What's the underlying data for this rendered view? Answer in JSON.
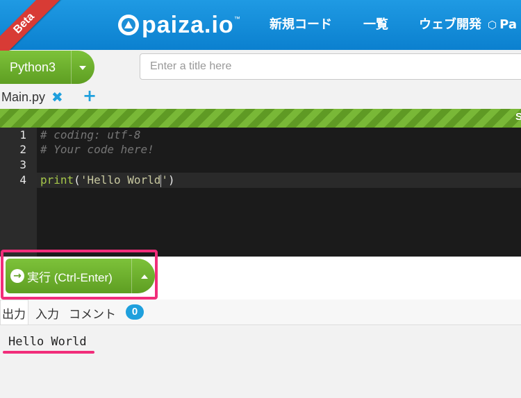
{
  "header": {
    "beta_label": "Beta",
    "logo_text": "paiza.io",
    "logo_tm": "™",
    "nav": [
      {
        "label": "新規コード"
      },
      {
        "label": "一覧"
      },
      {
        "label": "ウェブ開発"
      },
      {
        "label": "Pa"
      }
    ],
    "accent": "#1a93dc"
  },
  "toolbar": {
    "language": "Python3",
    "title_placeholder": "Enter a title here",
    "title_value": ""
  },
  "tabs": {
    "file_name": "Main.py",
    "close_icon": "✖",
    "add_icon": "+"
  },
  "stripe_bar_text": "S",
  "editor": {
    "line_numbers": [
      "1",
      "2",
      "3",
      "4"
    ],
    "lines": {
      "l1": "# coding: utf-8",
      "l2": "# Your code here!",
      "l4_fn": "print",
      "l4_open": "(",
      "l4_str_a": "'Hello World",
      "l4_str_b": "'",
      "l4_close": ")"
    },
    "active_line": 4
  },
  "run": {
    "label": "実行 (Ctrl-Enter)",
    "icon": "→",
    "highlight_color": "#f12d7a"
  },
  "output_tabs": {
    "output": "出力",
    "input": "入力",
    "comments": "コメント",
    "comment_count": "0"
  },
  "output": {
    "text": "Hello World"
  },
  "colors": {
    "brand_green": "#6aad2b",
    "brand_blue": "#1fa0dd",
    "highlight_pink": "#f12d7a"
  }
}
